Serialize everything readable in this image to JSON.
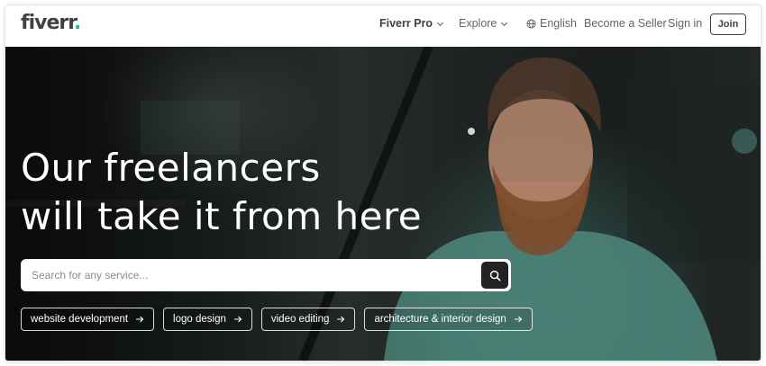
{
  "header": {
    "logo_text": "fiverr",
    "logo_dot": ".",
    "nav": {
      "pro": "Fiverr Pro",
      "explore": "Explore",
      "language": "English",
      "become_seller": "Become a Seller",
      "sign_in": "Sign in",
      "join": "Join"
    }
  },
  "hero": {
    "headline_line1": "Our freelancers",
    "headline_line2": "will take it from here",
    "search": {
      "placeholder": "Search for any service..."
    },
    "chips": [
      {
        "label": "website development"
      },
      {
        "label": "logo design"
      },
      {
        "label": "video editing"
      },
      {
        "label": "architecture & interior design"
      }
    ]
  },
  "colors": {
    "brand_green": "#1dbf73",
    "text_dark": "#404145",
    "search_button": "#222325"
  },
  "icons": [
    "chevron-down-icon",
    "globe-icon",
    "search-icon",
    "arrow-right-icon"
  ]
}
